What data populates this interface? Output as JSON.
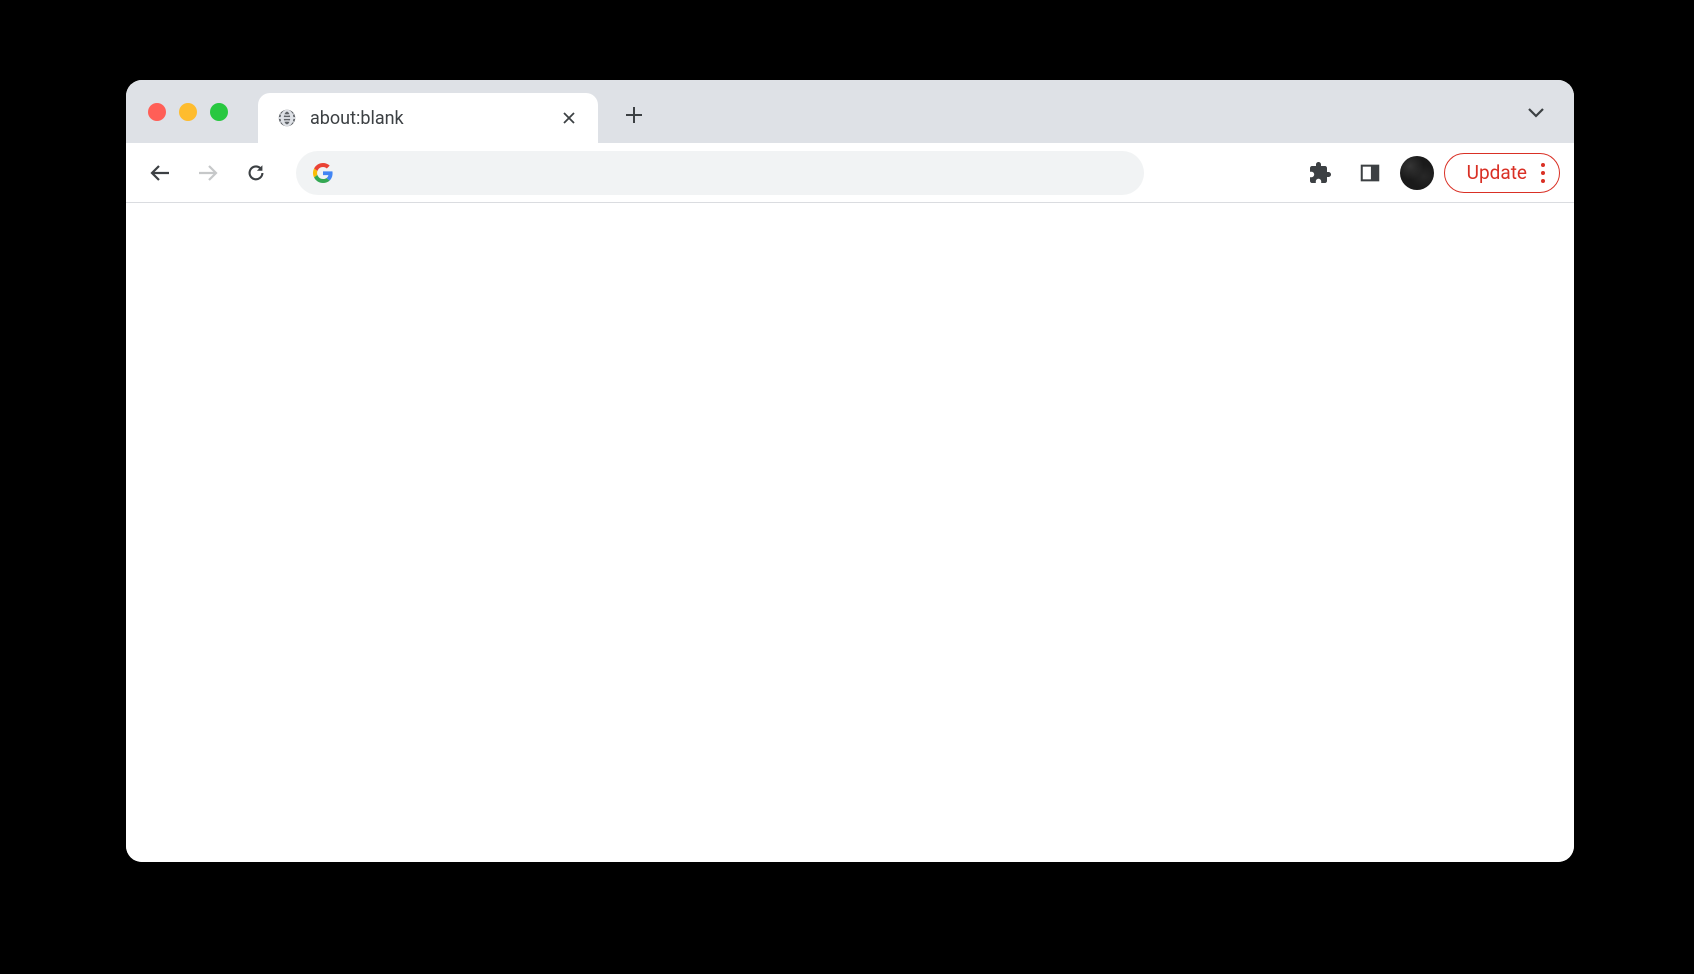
{
  "tab": {
    "title": "about:blank"
  },
  "toolbar": {
    "address_value": "",
    "update_label": "Update"
  },
  "colors": {
    "update_accent": "#d93025",
    "tab_bar_bg": "#dee1e6",
    "address_bar_bg": "#f1f3f4"
  }
}
